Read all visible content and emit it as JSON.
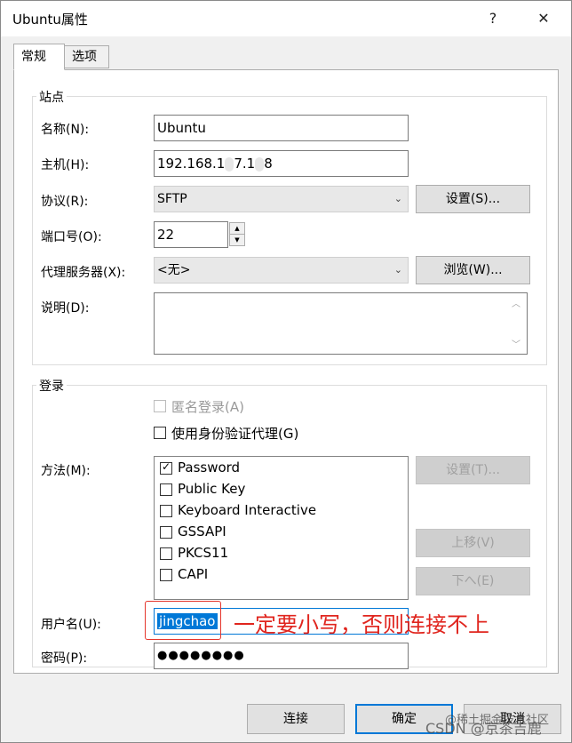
{
  "window": {
    "title": "Ubuntu属性",
    "help_glyph": "?",
    "close_glyph": "✕"
  },
  "tabs": [
    {
      "label": "常规"
    },
    {
      "label": "选项"
    }
  ],
  "site": {
    "group_label": "站点",
    "name_label": "名称(N):",
    "name_value": "Ubuntu",
    "host_label": "主机(H):",
    "host_value_a": "192.168.1",
    "host_value_b": "7.1",
    "host_value_c": "8",
    "protocol_label": "协议(R):",
    "protocol_value": "SFTP",
    "settings_button": "设置(S)...",
    "port_label": "端口号(O):",
    "port_value": "22",
    "proxy_label": "代理服务器(X):",
    "proxy_value": "<无>",
    "browse_button": "浏览(W)...",
    "desc_label": "说明(D):",
    "desc_value": ""
  },
  "login": {
    "group_label": "登录",
    "anonymous_label": "匿名登录(A)",
    "agent_label": "使用身份验证代理(G)",
    "method_label": "方法(M):",
    "methods": [
      {
        "label": "Password",
        "checked": true
      },
      {
        "label": "Public Key",
        "checked": false
      },
      {
        "label": "Keyboard Interactive",
        "checked": false
      },
      {
        "label": "GSSAPI",
        "checked": false
      },
      {
        "label": "PKCS11",
        "checked": false
      },
      {
        "label": "CAPI",
        "checked": false
      }
    ],
    "method_settings_button": "设置(T)...",
    "move_up_button": "上移(V)",
    "move_down_button": "下へ(E)",
    "username_label": "用户名(U):",
    "username_value": "jingchao",
    "password_label": "密码(P):",
    "password_value": "●●●●●●●●"
  },
  "annotation": {
    "text": "一定要小写，否则连接不上",
    "color": "#e0251e"
  },
  "footer": {
    "connect_button": "连接",
    "ok_button": "确定",
    "cancel_button": "取消"
  },
  "watermark": {
    "line1": "@稀土掘金技术社区",
    "line2": "CSDN @京茶吉鹿"
  },
  "check_glyph": "✓",
  "spin_up": "▲",
  "spin_down": "▼",
  "dropdown_glyph": "⌄",
  "scroll_up": "︿",
  "scroll_down": "﹀"
}
